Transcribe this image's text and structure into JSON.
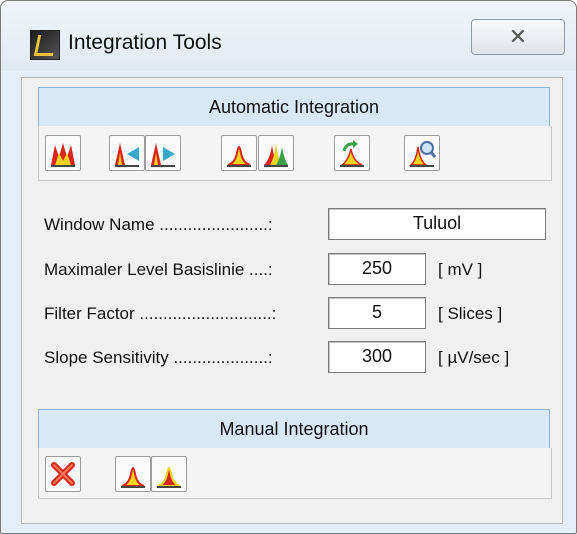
{
  "window": {
    "title": "Integration Tools",
    "close_label": "✕"
  },
  "automatic": {
    "header": "Automatic Integration",
    "tools": [
      {
        "icon": "multi-peak-red-icon"
      },
      {
        "icon": "peak-start-left-icon"
      },
      {
        "icon": "peak-end-right-icon"
      },
      {
        "icon": "single-peak-icon"
      },
      {
        "icon": "overlapping-peaks-icon"
      },
      {
        "icon": "peak-green-arrow-icon"
      },
      {
        "icon": "peak-zoom-icon"
      }
    ]
  },
  "fields": {
    "window_name": {
      "label": "Window Name .......................:",
      "value": "Tuluol"
    },
    "max_level": {
      "label": "Maximaler Level Basislinie ....:",
      "value": "250",
      "unit": "[ mV ]"
    },
    "filter": {
      "label": "Filter Factor ............................:",
      "value": "5",
      "unit": "[ Slices ]"
    },
    "slope": {
      "label": "Slope Sensitivity ....................:",
      "value": "300",
      "unit": "[ µV/sec ]"
    }
  },
  "manual": {
    "header": "Manual Integration",
    "tools": [
      {
        "icon": "delete-x-icon"
      },
      {
        "icon": "single-peak-icon"
      },
      {
        "icon": "single-peak-red-icon"
      }
    ]
  },
  "colors": {
    "header_bg": "#d9e8f7",
    "header_border": "#8fb4d9",
    "peak_red": "#d8261b",
    "peak_yellow": "#f2d321"
  }
}
